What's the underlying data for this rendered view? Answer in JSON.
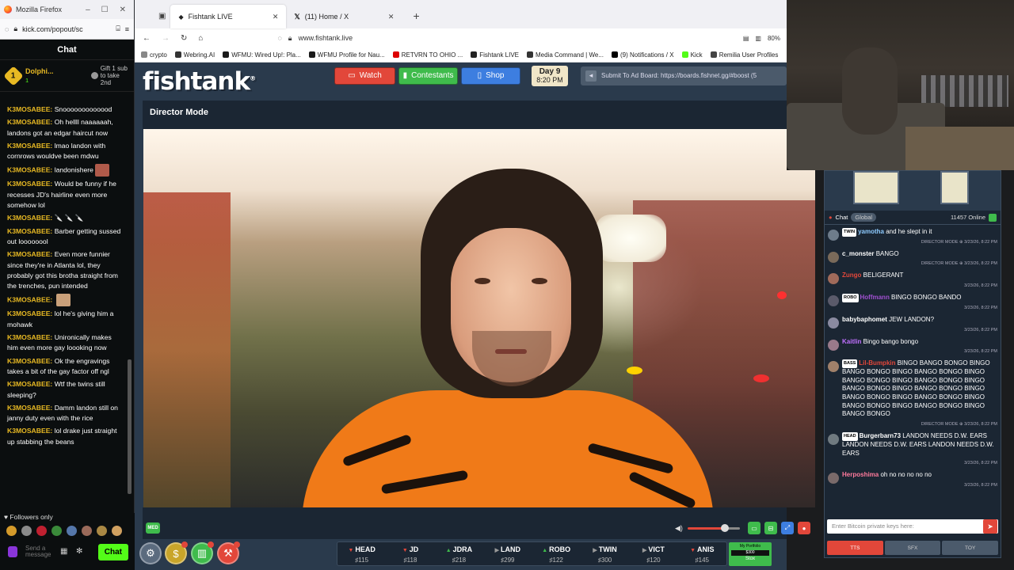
{
  "kick": {
    "window_title": "Mozilla Firefox",
    "url": "kick.com/popout/sc",
    "chat_title": "Chat",
    "pinned": {
      "user": "Dolphi...",
      "level": "1",
      "gift_line1": "Gift 1 sub",
      "gift_line2": "to take",
      "gift_line3": "2nd"
    },
    "messages": [
      {
        "user": "K3MOSABEE:",
        "text": "Snooooooooooood"
      },
      {
        "user": "K3MOSABEE:",
        "text": "Oh hellll naaaaaah, landons got an edgar haircut now"
      },
      {
        "user": "K3MOSABEE:",
        "text": "lmao landon with cornrows wouldve been mdwu"
      },
      {
        "user": "K3MOSABEE:",
        "text": "landonishere",
        "emote": "#b05a4a"
      },
      {
        "user": "K3MOSABEE:",
        "text": "Would be funny if he recesses JD's hairline even more somehow lol"
      },
      {
        "user": "K3MOSABEE:",
        "text": "🔪 🔪 🔪"
      },
      {
        "user": "K3MOSABEE:",
        "text": "Barber getting sussed out loooooool"
      },
      {
        "user": "K3MOSABEE:",
        "text": "Even more funnier since they're in Atlanta lol, they probably got this brotha straight from the trenches, pun intended"
      },
      {
        "user": "K3MOSABEE:",
        "text": "",
        "emote": "#c9a07a"
      },
      {
        "user": "K3MOSABEE:",
        "text": "lol he's giving him a mohawk"
      },
      {
        "user": "K3MOSABEE:",
        "text": "Unironically makes him even more gay loooking now"
      },
      {
        "user": "K3MOSABEE:",
        "text": "Ok the engravings takes a bit of the gay factor off ngl"
      },
      {
        "user": "K3MOSABEE:",
        "text": "Wtf the twins still sleeping?"
      },
      {
        "user": "K3MOSABEE:",
        "text": "Damm landon still on janny duty even with the rice"
      },
      {
        "user": "K3MOSABEE:",
        "text": "lol drake just straight up stabbing the beans"
      }
    ],
    "followers_only": "Followers only",
    "input_placeholder": "Send a message",
    "chat_button": "Chat"
  },
  "browser": {
    "tabs": [
      {
        "label": "Fishtank LIVE"
      },
      {
        "label": "(11) Home / X"
      }
    ],
    "address": "www.fishtank.live",
    "zoom": "80%",
    "bookmarks": [
      "crypto",
      "Webring.AI",
      "WFMU: Wired Up!: Pla...",
      "WFMU Profile for Nau...",
      "RETVRN TO OHIO ...",
      "Fishtank LIVE",
      "Media Command | We...",
      "(9) Notifications / X",
      "Kick",
      "Remilia User Profiles"
    ]
  },
  "site": {
    "logo": "fishtank",
    "nav": {
      "watch": "Watch",
      "contestants": "Contestants",
      "shop": "Shop"
    },
    "day": "Day 9",
    "time": "8:20 PM",
    "adboard": "Submit To Ad Board: https://boards.fishnet.gg/#boost (5",
    "director_mode": "Director Mode",
    "quality": "MED",
    "rooms": [
      {
        "name": "HEAD",
        "count": "115",
        "trend": "down"
      },
      {
        "name": "JD",
        "count": "118",
        "trend": "down"
      },
      {
        "name": "JDRA",
        "count": "218",
        "trend": "up"
      },
      {
        "name": "LAND",
        "count": "299",
        "trend": "flat"
      },
      {
        "name": "ROBO",
        "count": "122",
        "trend": "up"
      },
      {
        "name": "TWIN",
        "count": "300",
        "trend": "flat"
      },
      {
        "name": "VICT",
        "count": "120",
        "trend": "flat"
      },
      {
        "name": "ANIS",
        "count": "145",
        "trend": "down"
      }
    ],
    "portfolio": {
      "title": "My Portfolio",
      "value": "$300",
      "label": "Stox"
    },
    "volume": 0.72
  },
  "chat": {
    "label": "Chat",
    "scope": "Global",
    "online": "11457 Online",
    "messages": [
      {
        "tag": "TWIN",
        "name": "yamotha",
        "color": "#8ecbff",
        "text": "and he slept in it",
        "meta": "DIRECTOR MODE ⊕ 3/23/26, 8:22 PM"
      },
      {
        "tag": "",
        "name": "c_monster",
        "color": "#ffffff",
        "text": "BANGO",
        "meta": "DIRECTOR MODE ⊕ 3/23/26, 8:22 PM"
      },
      {
        "tag": "",
        "name": "Zungo",
        "color": "#e2473a",
        "text": "BELIGERANT",
        "meta": "3/23/26, 8:22 PM"
      },
      {
        "tag": "ROBO",
        "name": "Hoffmann",
        "color": "#a050d0",
        "text": "BINGO BONGO BANDO",
        "meta": "3/23/26, 8:22 PM"
      },
      {
        "tag": "",
        "name": "babybaphomet",
        "color": "#ffffff",
        "text": "JEW LANDON?",
        "meta": "3/23/26, 8:22 PM"
      },
      {
        "tag": "",
        "name": "Kaitlin",
        "color": "#c070ff",
        "text": "Bingo bango bongo",
        "meta": "3/23/26, 8:22 PM"
      },
      {
        "tag": "BASS",
        "name": "Lil-Bumpkin",
        "color": "#e2473a",
        "text": "BINGO BANGO BONGO BINGO BANGO BONGO BINGO BANGO BONGO BINGO BANGO BONGO BINGO BANGO BONGO BINGO BANGO BONGO BINGO BANGO BONGO BINGO BANGO BONGO BINGO BANGO BONGO BINGO BANGO BONGO BINGO BANGO BONGO BINGO BANGO BONGO",
        "meta": "DIRECTOR MODE ⊕ 3/23/26, 8:22 PM"
      },
      {
        "tag": "HEAD",
        "name": "Burgerbarn73",
        "color": "#ffffff",
        "text": "LANDON NEEDS D.W. EARS LANDON NEEDS D.W. EARS LANDON NEEDS D.W. EARS",
        "meta": "3/23/26, 8:22 PM"
      },
      {
        "tag": "",
        "name": "Herposhima",
        "color": "#ff7a9c",
        "text": "oh no no no no no",
        "meta": "3/23/26, 8:22 PM"
      }
    ],
    "input_placeholder": "Enter Bitcoin private keys here:",
    "tabs": [
      "TTS",
      "SFX",
      "TOY"
    ]
  }
}
